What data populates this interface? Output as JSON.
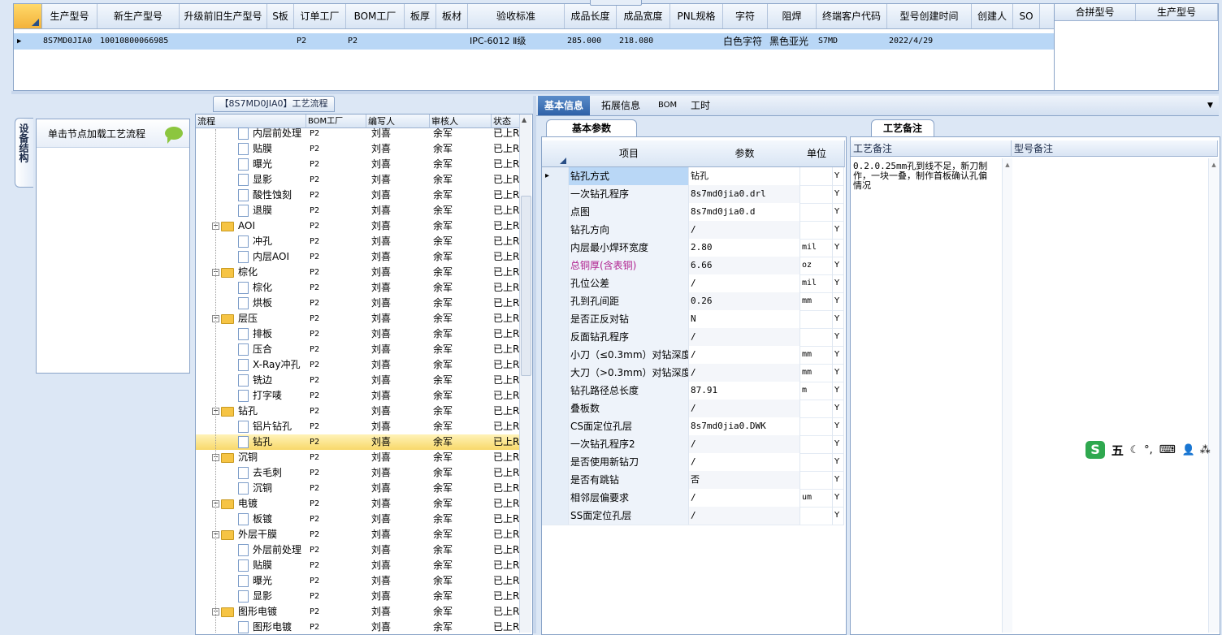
{
  "top_grid": {
    "headers": [
      "生产型号",
      "新生产型号",
      "升级前旧生产型号",
      "S板",
      "订单工厂",
      "BOM工厂",
      "板厚",
      "板材",
      "验收标准",
      "成品长度",
      "成品宽度",
      "PNL规格",
      "字符",
      "阻焊",
      "终端客户代码",
      "型号创建时间",
      "创建人",
      "SO"
    ],
    "row": {
      "model": "8S7MD0JIA0",
      "new_model": "10010800066985",
      "order_factory": "P2",
      "bom_factory": "P2",
      "standard": "IPC-6012 Ⅱ级",
      "length": "285.000",
      "width": "218.080",
      "character": "白色字符",
      "solder_mask": "黑色亚光",
      "customer_code": "S7MD",
      "created": "2022/4/29"
    }
  },
  "right_grid": {
    "headers": [
      "合拼型号",
      "生产型号"
    ]
  },
  "left_panel": {
    "vertical_tab": "设备结构",
    "title": "单击节点加载工艺流程"
  },
  "tree_panel": {
    "caption": "【8S7MD0JIA0】工艺流程",
    "headers": [
      "流程",
      "BOM工厂",
      "编写人",
      "审核人",
      "状态"
    ],
    "rows": [
      {
        "label": "内层前处理",
        "level": 2,
        "type": "file",
        "bom": "P2",
        "author": "刘喜",
        "reviewer": "余军",
        "status": "已上R"
      },
      {
        "label": "贴膜",
        "level": 2,
        "type": "file",
        "bom": "P2",
        "author": "刘喜",
        "reviewer": "余军",
        "status": "已上R"
      },
      {
        "label": "曝光",
        "level": 2,
        "type": "file",
        "bom": "P2",
        "author": "刘喜",
        "reviewer": "余军",
        "status": "已上R"
      },
      {
        "label": "显影",
        "level": 2,
        "type": "file",
        "bom": "P2",
        "author": "刘喜",
        "reviewer": "余军",
        "status": "已上R"
      },
      {
        "label": "酸性蚀刻",
        "level": 2,
        "type": "file",
        "bom": "P2",
        "author": "刘喜",
        "reviewer": "余军",
        "status": "已上R"
      },
      {
        "label": "退膜",
        "level": 2,
        "type": "file",
        "bom": "P2",
        "author": "刘喜",
        "reviewer": "余军",
        "status": "已上R"
      },
      {
        "label": "AOI",
        "level": 1,
        "type": "folder",
        "bom": "P2",
        "author": "刘喜",
        "reviewer": "余军",
        "status": "已上R"
      },
      {
        "label": "冲孔",
        "level": 2,
        "type": "file",
        "bom": "P2",
        "author": "刘喜",
        "reviewer": "余军",
        "status": "已上R"
      },
      {
        "label": "内层AOI",
        "level": 2,
        "type": "file",
        "bom": "P2",
        "author": "刘喜",
        "reviewer": "余军",
        "status": "已上R"
      },
      {
        "label": "棕化",
        "level": 1,
        "type": "folder",
        "bom": "P2",
        "author": "刘喜",
        "reviewer": "余军",
        "status": "已上R"
      },
      {
        "label": "棕化",
        "level": 2,
        "type": "file",
        "bom": "P2",
        "author": "刘喜",
        "reviewer": "余军",
        "status": "已上R"
      },
      {
        "label": "烘板",
        "level": 2,
        "type": "file",
        "bom": "P2",
        "author": "刘喜",
        "reviewer": "余军",
        "status": "已上R"
      },
      {
        "label": "层压",
        "level": 1,
        "type": "folder",
        "bom": "P2",
        "author": "刘喜",
        "reviewer": "余军",
        "status": "已上R"
      },
      {
        "label": "排板",
        "level": 2,
        "type": "file",
        "bom": "P2",
        "author": "刘喜",
        "reviewer": "余军",
        "status": "已上R"
      },
      {
        "label": "压合",
        "level": 2,
        "type": "file",
        "bom": "P2",
        "author": "刘喜",
        "reviewer": "余军",
        "status": "已上R"
      },
      {
        "label": "X-Ray冲孔",
        "level": 2,
        "type": "file",
        "bom": "P2",
        "author": "刘喜",
        "reviewer": "余军",
        "status": "已上R"
      },
      {
        "label": "铣边",
        "level": 2,
        "type": "file",
        "bom": "P2",
        "author": "刘喜",
        "reviewer": "余军",
        "status": "已上R"
      },
      {
        "label": "打字唛",
        "level": 2,
        "type": "file",
        "bom": "P2",
        "author": "刘喜",
        "reviewer": "余军",
        "status": "已上R"
      },
      {
        "label": "钻孔",
        "level": 1,
        "type": "folder",
        "bom": "P2",
        "author": "刘喜",
        "reviewer": "余军",
        "status": "已上R"
      },
      {
        "label": "铝片钻孔",
        "level": 2,
        "type": "file",
        "bom": "P2",
        "author": "刘喜",
        "reviewer": "余军",
        "status": "已上R"
      },
      {
        "label": "钻孔",
        "level": 2,
        "type": "file",
        "bom": "P2",
        "author": "刘喜",
        "reviewer": "余军",
        "status": "已上R",
        "selected": true
      },
      {
        "label": "沉铜",
        "level": 1,
        "type": "folder",
        "bom": "P2",
        "author": "刘喜",
        "reviewer": "余军",
        "status": "已上R"
      },
      {
        "label": "去毛刺",
        "level": 2,
        "type": "file",
        "bom": "P2",
        "author": "刘喜",
        "reviewer": "余军",
        "status": "已上R"
      },
      {
        "label": "沉铜",
        "level": 2,
        "type": "file",
        "bom": "P2",
        "author": "刘喜",
        "reviewer": "余军",
        "status": "已上R"
      },
      {
        "label": "电镀",
        "level": 1,
        "type": "folder",
        "bom": "P2",
        "author": "刘喜",
        "reviewer": "余军",
        "status": "已上R"
      },
      {
        "label": "板镀",
        "level": 2,
        "type": "file",
        "bom": "P2",
        "author": "刘喜",
        "reviewer": "余军",
        "status": "已上R"
      },
      {
        "label": "外层干膜",
        "level": 1,
        "type": "folder",
        "bom": "P2",
        "author": "刘喜",
        "reviewer": "余军",
        "status": "已上R"
      },
      {
        "label": "外层前处理",
        "level": 2,
        "type": "file",
        "bom": "P2",
        "author": "刘喜",
        "reviewer": "余军",
        "status": "已上R"
      },
      {
        "label": "贴膜",
        "level": 2,
        "type": "file",
        "bom": "P2",
        "author": "刘喜",
        "reviewer": "余军",
        "status": "已上R"
      },
      {
        "label": "曝光",
        "level": 2,
        "type": "file",
        "bom": "P2",
        "author": "刘喜",
        "reviewer": "余军",
        "status": "已上R"
      },
      {
        "label": "显影",
        "level": 2,
        "type": "file",
        "bom": "P2",
        "author": "刘喜",
        "reviewer": "余军",
        "status": "已上R"
      },
      {
        "label": "图形电镀",
        "level": 1,
        "type": "folder",
        "bom": "P2",
        "author": "刘喜",
        "reviewer": "余军",
        "status": "已上R"
      },
      {
        "label": "图形电镀",
        "level": 2,
        "type": "file",
        "bom": "P2",
        "author": "刘喜",
        "reviewer": "余军",
        "status": "已上R"
      }
    ]
  },
  "right_tabs": [
    "基本信息",
    "拓展信息",
    "BOM",
    "工时"
  ],
  "params": {
    "subtab": "基本参数",
    "headers": [
      "项目",
      "参数",
      "单位"
    ],
    "rows": [
      {
        "item": "钻孔方式",
        "value": "钻孔",
        "unit": "",
        "flag": "Y",
        "current": true
      },
      {
        "item": "一次钻孔程序",
        "value": "8s7md0jia0.drl",
        "unit": "",
        "flag": "Y"
      },
      {
        "item": "点图",
        "value": "8s7md0jia0.d",
        "unit": "",
        "flag": "Y"
      },
      {
        "item": "钻孔方向",
        "value": "/",
        "unit": "",
        "flag": "Y"
      },
      {
        "item": "内层最小焊环宽度",
        "value": "2.80",
        "unit": "mil",
        "flag": "Y"
      },
      {
        "item": "总铜厚(含表铜)",
        "value": "6.66",
        "unit": "oz",
        "flag": "Y",
        "highlight": "#b0218f"
      },
      {
        "item": "孔位公差",
        "value": "/",
        "unit": "mil",
        "flag": "Y"
      },
      {
        "item": "孔到孔间距",
        "value": "0.26",
        "unit": "mm",
        "flag": "Y"
      },
      {
        "item": "是否正反对钻",
        "value": "N",
        "unit": "",
        "flag": "Y"
      },
      {
        "item": "反面钻孔程序",
        "value": "/",
        "unit": "",
        "flag": "Y"
      },
      {
        "item": "小刀（≤0.3mm）对钻深度",
        "value": "/",
        "unit": "mm",
        "flag": "Y"
      },
      {
        "item": "大刀（>0.3mm）对钻深度",
        "value": "/",
        "unit": "mm",
        "flag": "Y"
      },
      {
        "item": "钻孔路径总长度",
        "value": "87.91",
        "unit": "m",
        "flag": "Y"
      },
      {
        "item": "叠板数",
        "value": "/",
        "unit": "",
        "flag": "Y"
      },
      {
        "item": "CS面定位孔层",
        "value": "8s7md0jia0.DWK",
        "unit": "",
        "flag": "Y"
      },
      {
        "item": "一次钻孔程序2",
        "value": "/",
        "unit": "",
        "flag": "Y"
      },
      {
        "item": "是否使用新钻刀",
        "value": "/",
        "unit": "",
        "flag": "Y"
      },
      {
        "item": "是否有跳钻",
        "value": "否",
        "unit": "",
        "flag": "Y"
      },
      {
        "item": "相邻层偏要求",
        "value": "/",
        "unit": "um",
        "flag": "Y"
      },
      {
        "item": "SS面定位孔层",
        "value": "/",
        "unit": "",
        "flag": "Y"
      }
    ]
  },
  "notes": {
    "subtab": "工艺备注",
    "col1": "工艺备注",
    "col2": "型号备注",
    "process_note": "0.2.0.25mm孔到线不足，新刀制作，一块一叠，制作首板确认孔偏情况",
    "model_note": ""
  },
  "ime": {
    "label": "五",
    "icon_names": [
      "sogou-s-icon",
      "moon-icon",
      "punctuation-icon",
      "keyboard-icon",
      "user-icon",
      "grid-icon"
    ]
  },
  "colors": {
    "accent": "#2f62a8",
    "selection": "#f8d86a",
    "row_selected": "#b9d7f6"
  }
}
